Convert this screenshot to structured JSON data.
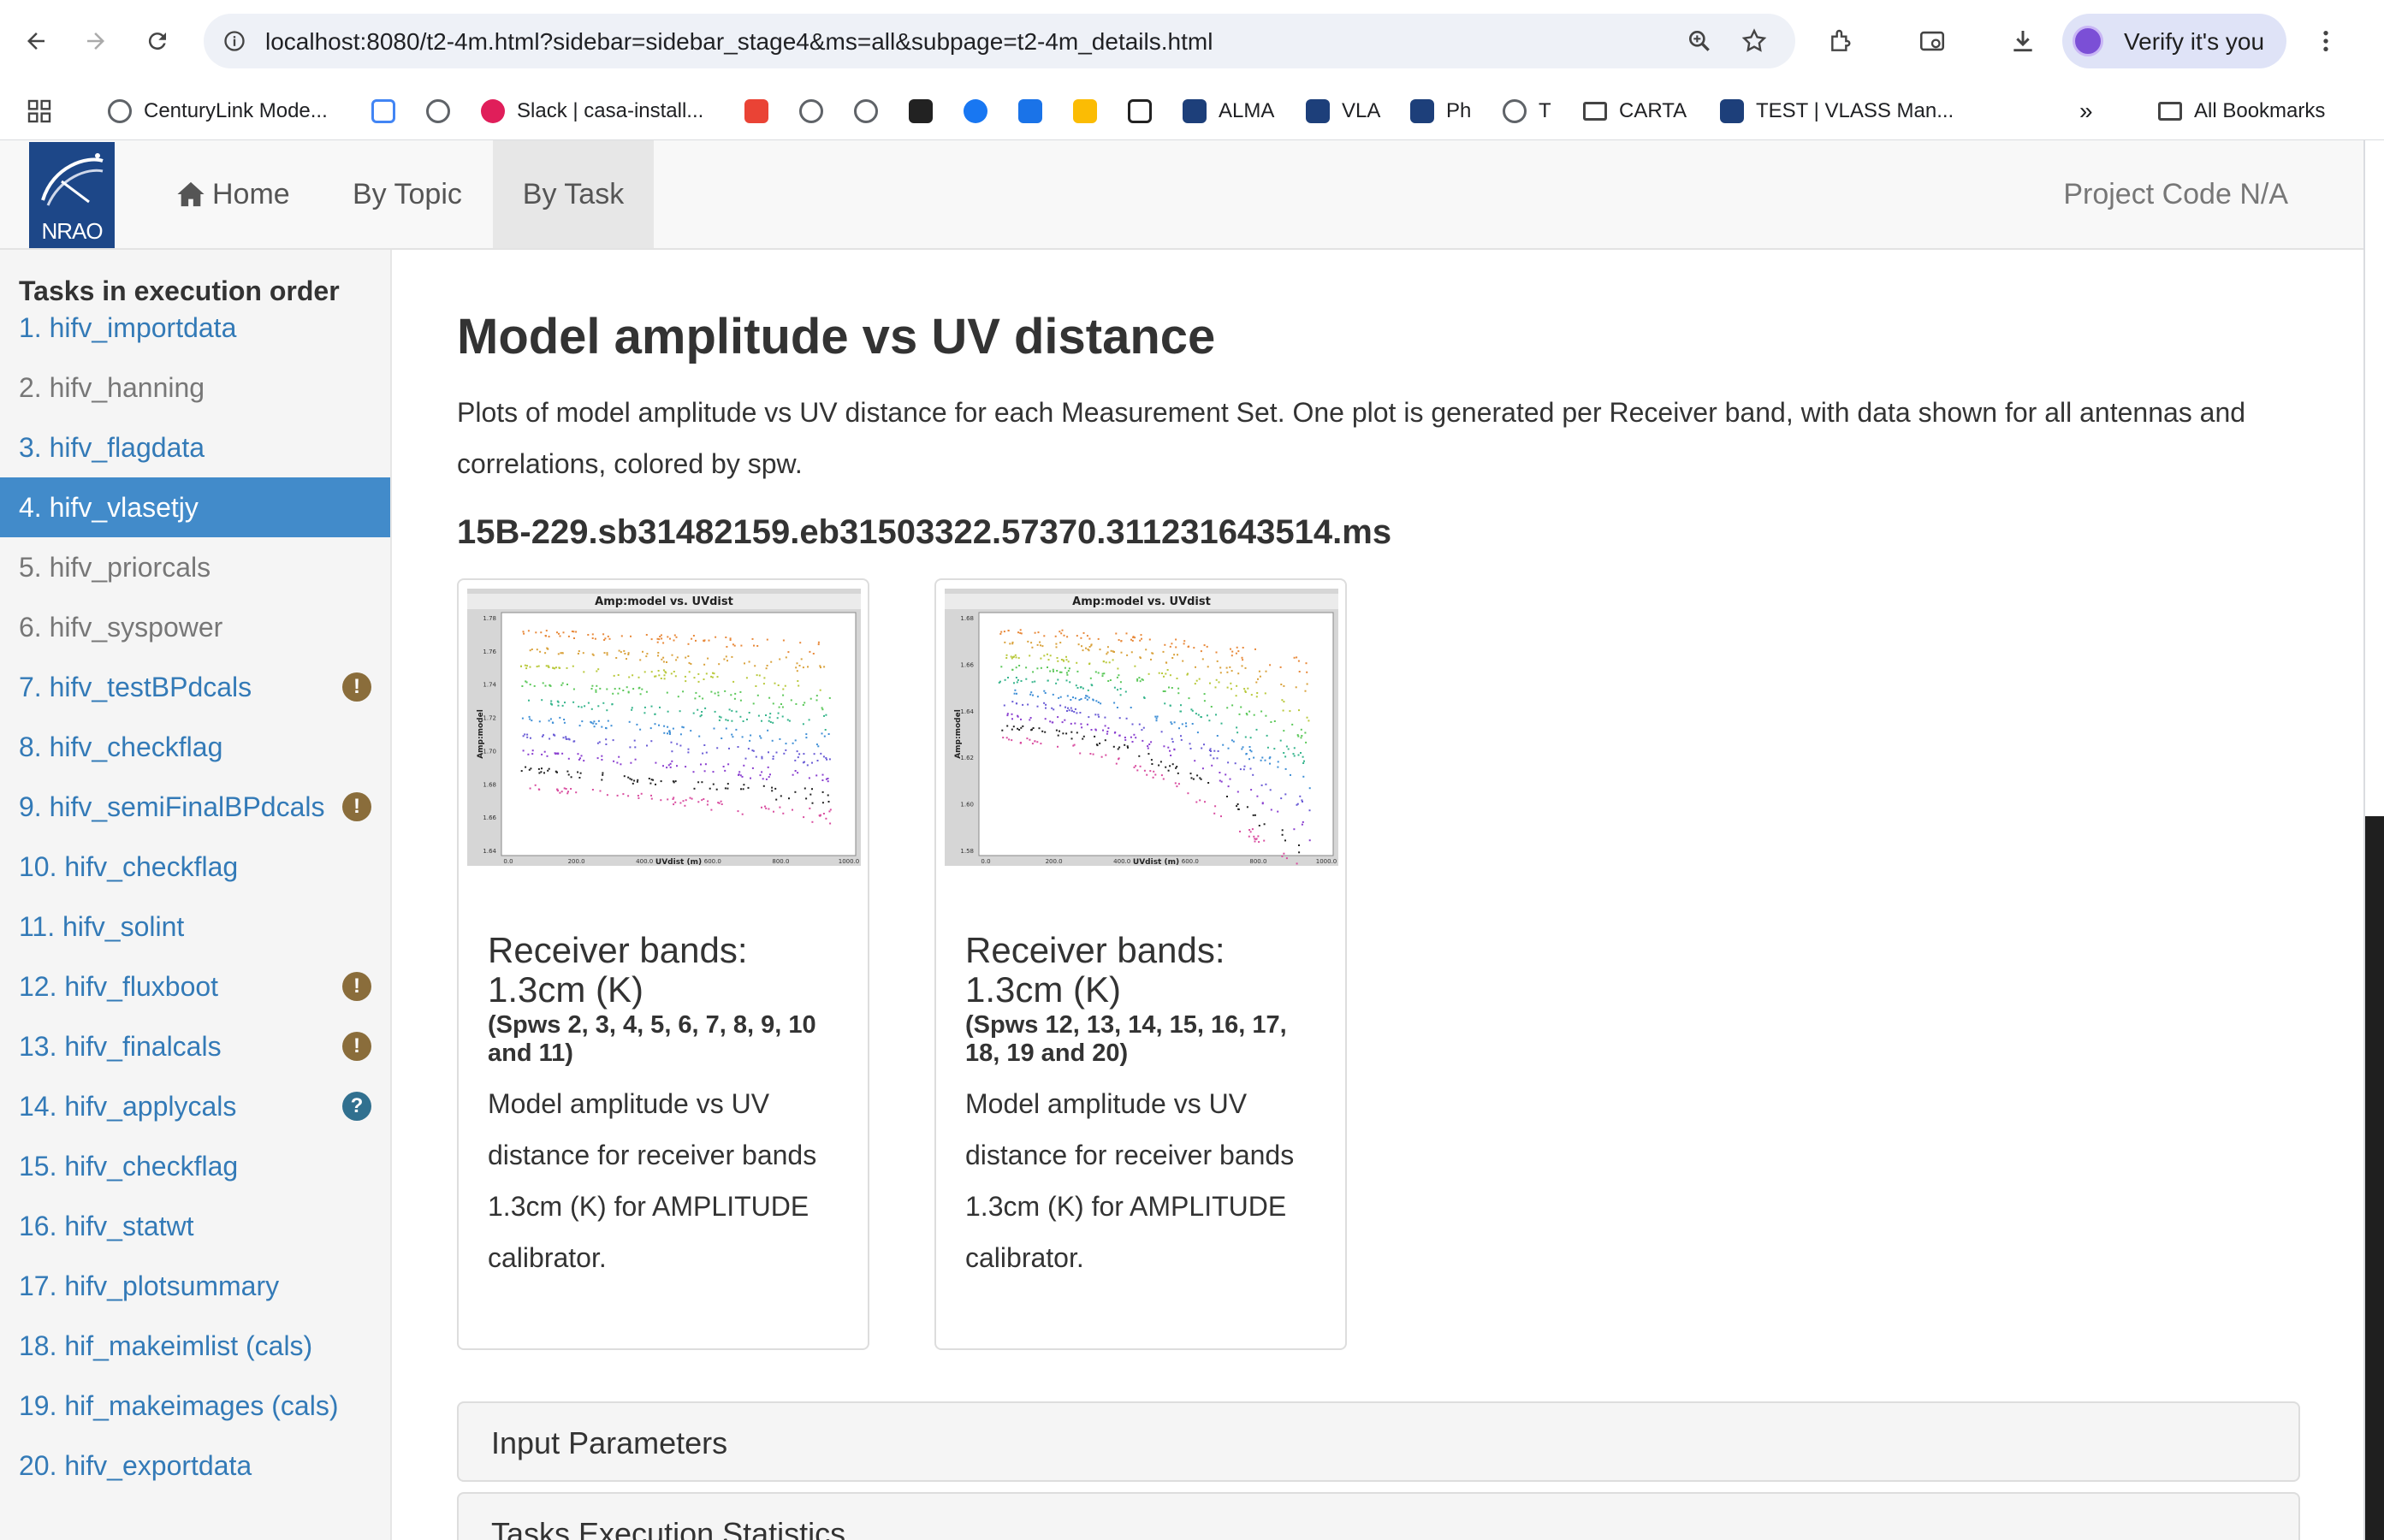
{
  "browser": {
    "url": "localhost:8080/t2-4m.html?sidebar=sidebar_stage4&ms=all&subpage=t2-4m_details.html",
    "profile_label": "Verify it's you",
    "bookmarks": [
      {
        "label": "CenturyLink Mode...",
        "icon": "globe-icon"
      },
      {
        "label": "",
        "icon": "calendar-icon"
      },
      {
        "label": "",
        "icon": "globe-icon"
      },
      {
        "label": "Slack | casa-install...",
        "icon": "slack-icon"
      },
      {
        "label": "",
        "icon": "gmail-icon"
      },
      {
        "label": "",
        "icon": "globe-icon"
      },
      {
        "label": "",
        "icon": "globe-icon"
      },
      {
        "label": "",
        "icon": "wu-icon"
      },
      {
        "label": "",
        "icon": "facebook-icon"
      },
      {
        "label": "",
        "icon": "check-icon"
      },
      {
        "label": "",
        "icon": "keep-icon"
      },
      {
        "label": "",
        "icon": "amazon-icon"
      },
      {
        "label": "ALMA",
        "icon": "alma-icon"
      },
      {
        "label": "VLA",
        "icon": "alma-icon"
      },
      {
        "label": "Ph",
        "icon": "alma-icon"
      },
      {
        "label": "T",
        "icon": "globe-icon"
      },
      {
        "label": "CARTA",
        "icon": "folder-icon"
      },
      {
        "label": "TEST | VLASS Man...",
        "icon": "alma-icon"
      }
    ],
    "more_bookmarks": "»",
    "all_bookmarks": "All Bookmarks"
  },
  "navbar": {
    "logo_text": "NRAO",
    "home": "Home",
    "by_topic": "By Topic",
    "by_task": "By Task",
    "project_code": "Project Code N/A"
  },
  "sidebar": {
    "heading": "Tasks in execution order",
    "tasks": [
      {
        "label": "1. hifv_importdata",
        "state": "link",
        "badge": ""
      },
      {
        "label": "2. hifv_hanning",
        "state": "disabled",
        "badge": ""
      },
      {
        "label": "3. hifv_flagdata",
        "state": "link",
        "badge": ""
      },
      {
        "label": "4. hifv_vlasetjy",
        "state": "active",
        "badge": ""
      },
      {
        "label": "5. hifv_priorcals",
        "state": "disabled",
        "badge": ""
      },
      {
        "label": "6. hifv_syspower",
        "state": "disabled",
        "badge": ""
      },
      {
        "label": "7. hifv_testBPdcals",
        "state": "link",
        "badge": "!"
      },
      {
        "label": "8. hifv_checkflag",
        "state": "link",
        "badge": ""
      },
      {
        "label": "9. hifv_semiFinalBPdcals",
        "state": "link",
        "badge": "!"
      },
      {
        "label": "10. hifv_checkflag",
        "state": "link",
        "badge": ""
      },
      {
        "label": "11. hifv_solint",
        "state": "link",
        "badge": ""
      },
      {
        "label": "12. hifv_fluxboot",
        "state": "link",
        "badge": "!"
      },
      {
        "label": "13. hifv_finalcals",
        "state": "link",
        "badge": "!"
      },
      {
        "label": "14. hifv_applycals",
        "state": "link",
        "badge": "?"
      },
      {
        "label": "15. hifv_checkflag",
        "state": "link",
        "badge": ""
      },
      {
        "label": "16. hifv_statwt",
        "state": "link",
        "badge": ""
      },
      {
        "label": "17. hifv_plotsummary",
        "state": "link",
        "badge": ""
      },
      {
        "label": "18. hif_makeimlist (cals)",
        "state": "link",
        "badge": ""
      },
      {
        "label": "19. hif_makeimages (cals)",
        "state": "link",
        "badge": ""
      },
      {
        "label": "20. hifv_exportdata",
        "state": "link",
        "badge": ""
      }
    ]
  },
  "main": {
    "title": "Model amplitude vs UV distance",
    "description": "Plots of model amplitude vs UV distance for each Measurement Set. One plot is generated per Receiver band, with data shown for all antennas and correlations, colored by spw.",
    "ms_name": "15B-229.sb31482159.eb31503322.57370.311231643514.ms",
    "plots": [
      {
        "plot_title": "Amp:model vs. UVdist",
        "xlabel": "UVdist (m)",
        "ylabel": "Amp:model",
        "yticks": [
          "1.78",
          "1.76",
          "1.74",
          "1.72",
          "1.70",
          "1.68",
          "1.66",
          "1.64"
        ],
        "xticks": [
          "0.0",
          "200.0",
          "400.0",
          "600.0",
          "800.0",
          "1000.0"
        ],
        "caption_title": "Receiver bands: 1.3cm (K)",
        "caption_spws": "(Spws 2, 3, 4, 5, 6, 7, 8, 9, 10 and 11)",
        "caption_text": "Model amplitude vs UV distance for receiver bands 1.3cm (K) for AMPLITUDE calibrator."
      },
      {
        "plot_title": "Amp:model vs. UVdist",
        "xlabel": "UVdist (m)",
        "ylabel": "Amp:model",
        "yticks": [
          "1.68",
          "1.66",
          "1.64",
          "1.62",
          "1.60",
          "1.58"
        ],
        "xticks": [
          "0.0",
          "200.0",
          "400.0",
          "600.0",
          "800.0",
          "1000.0"
        ],
        "caption_title": "Receiver bands: 1.3cm (K)",
        "caption_spws": "(Spws 12, 13, 14, 15, 16, 17, 18, 19 and 20)",
        "caption_text": "Model amplitude vs UV distance for receiver bands 1.3cm (K) for AMPLITUDE calibrator."
      }
    ],
    "panels": [
      "Input Parameters",
      "Tasks Execution Statistics"
    ]
  },
  "colors": {
    "link": "#337ab7",
    "active_bg": "#428bca",
    "warning_badge": "#8a6d3b",
    "info_badge": "#31708f",
    "spw_colors": [
      "#e8893a",
      "#d9a23c",
      "#b9c93c",
      "#5cc85a",
      "#36b58c",
      "#3f8fd6",
      "#6a5cd6",
      "#8a3fd0",
      "#222222",
      "#d94ea0"
    ]
  }
}
